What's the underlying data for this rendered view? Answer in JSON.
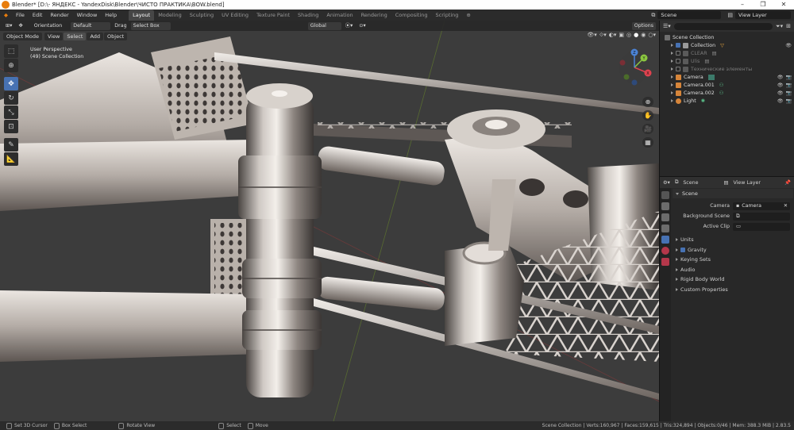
{
  "window": {
    "title": "Blender* [D:\\- ЯНДЕКС - YandexDisk\\Blender\\ЧИСТО ПРАКТИКА\\BOW.blend]"
  },
  "menu": [
    "File",
    "Edit",
    "Render",
    "Window",
    "Help"
  ],
  "workspaces": [
    "Layout",
    "Modeling",
    "Sculpting",
    "UV Editing",
    "Texture Paint",
    "Shading",
    "Animation",
    "Rendering",
    "Compositing",
    "Scripting"
  ],
  "scene_selector": {
    "label": "Scene",
    "view_layer": "View Layer"
  },
  "viewport_header": {
    "mode": "Object Mode",
    "view": "View",
    "select": "Select",
    "add": "Add",
    "object": "Object",
    "orientation_label": "Orientation",
    "orientation_value": "Default",
    "drag_label": "Drag",
    "drag_value": "Select Box",
    "transform_orientation": "Global",
    "options": "Options"
  },
  "viewport_info": {
    "line1": "User Perspective",
    "line2": "(49) Scene Collection"
  },
  "gizmo": {
    "x": "X",
    "y": "Y",
    "z": "Z"
  },
  "outliner": {
    "rows": [
      {
        "label": "Scene Collection",
        "level": 0,
        "dim": false,
        "check": false,
        "visible": false
      },
      {
        "label": "Collection",
        "level": 1,
        "dim": false,
        "check": true,
        "visible": true
      },
      {
        "label": "CLEAR",
        "level": 1,
        "dim": true,
        "check": false,
        "visible": false
      },
      {
        "label": "Ulis",
        "level": 1,
        "dim": true,
        "check": false,
        "visible": false
      },
      {
        "label": "Технические элементы",
        "level": 1,
        "dim": true,
        "check": false,
        "visible": false
      },
      {
        "label": "Camera",
        "level": 1,
        "dim": false,
        "check": false,
        "visible": true
      },
      {
        "label": "Camera.001",
        "level": 1,
        "dim": false,
        "check": false,
        "visible": true
      },
      {
        "label": "Camera.002",
        "level": 1,
        "dim": false,
        "check": false,
        "visible": true
      },
      {
        "label": "Light",
        "level": 1,
        "dim": false,
        "check": false,
        "visible": true
      }
    ]
  },
  "properties": {
    "header_scene": "Scene",
    "header_view_layer": "View Layer",
    "panel_title": "Scene",
    "camera_label": "Camera",
    "camera_value": "Camera",
    "background_scene_label": "Background Scene",
    "active_clip_label": "Active Clip",
    "subpanels": [
      "Units",
      "Gravity",
      "Keying Sets",
      "Audio",
      "Rigid Body World",
      "Custom Properties"
    ]
  },
  "statusbar": {
    "set_cursor": "Set 3D Cursor",
    "box_select": "Box Select",
    "rotate_view": "Rotate View",
    "select": "Select",
    "move": "Move",
    "stats": "Scene Collection | Verts:160,967 | Faces:159,615 | Tris:324,894 | Objects:0/46 | Mem: 388.3 MiB | 2.83.5"
  },
  "colors": {
    "accent": "#4772b3",
    "grid_red": "#8a3a3a",
    "grid_green": "#6a8a2a"
  }
}
